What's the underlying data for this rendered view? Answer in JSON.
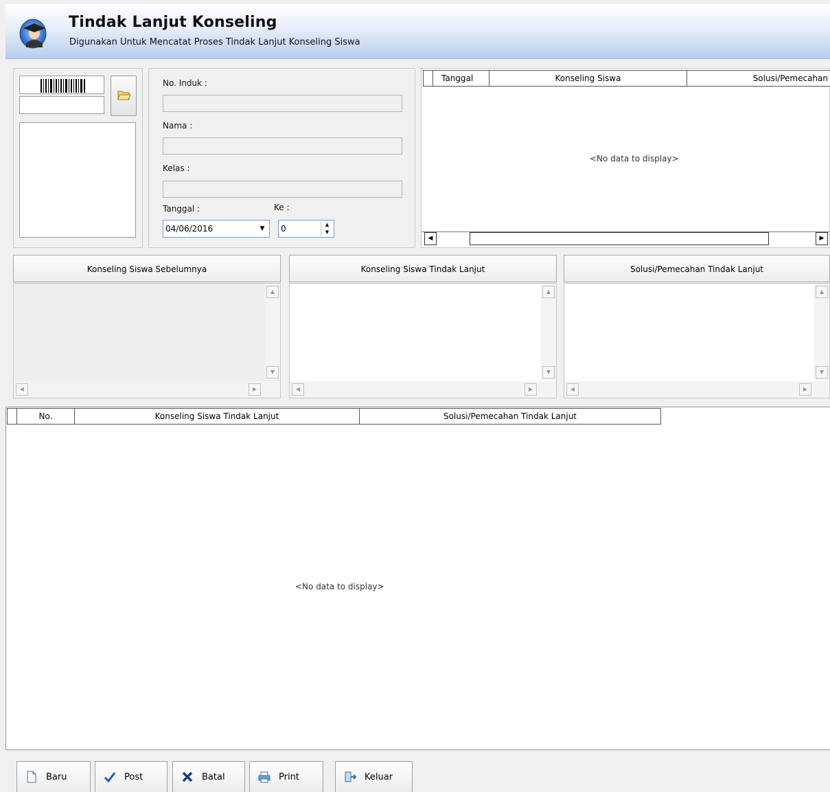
{
  "header": {
    "title": "Tindak Lanjut Konseling",
    "subtitle": "Digunakan Untuk Mencatat Proses Tindak Lanjut Konseling Siswa"
  },
  "student_form": {
    "no_induk_label": "No. Induk :",
    "nama_label": "Nama :",
    "kelas_label": "Kelas :",
    "tanggal_label": "Tanggal :",
    "ke_label": "Ke :",
    "tanggal_value": "04/06/2016",
    "ke_value": "0"
  },
  "history_grid": {
    "columns": [
      "Tanggal",
      "Konseling Siswa",
      "Solusi/Pemecahan"
    ],
    "empty_text": "<No data to display>"
  },
  "memos": {
    "previous_label": "Konseling Siswa Sebelumnya",
    "followup_label": "Konseling Siswa Tindak Lanjut",
    "solution_label": "Solusi/Pemecahan Tindak Lanjut"
  },
  "detail_grid": {
    "columns": [
      "No.",
      "Konseling Siswa Tindak Lanjut",
      "Solusi/Pemecahan Tindak Lanjut"
    ],
    "empty_text": "<No data to display>"
  },
  "toolbar": {
    "baru": "Baru",
    "post": "Post",
    "batal": "Batal",
    "print": "Print",
    "keluar": "Keluar"
  },
  "colors": {
    "header_gradient_bottom": "#b9cdee",
    "accent_blue": "#1f5fbf",
    "batal_red": "#1a3a8c"
  }
}
